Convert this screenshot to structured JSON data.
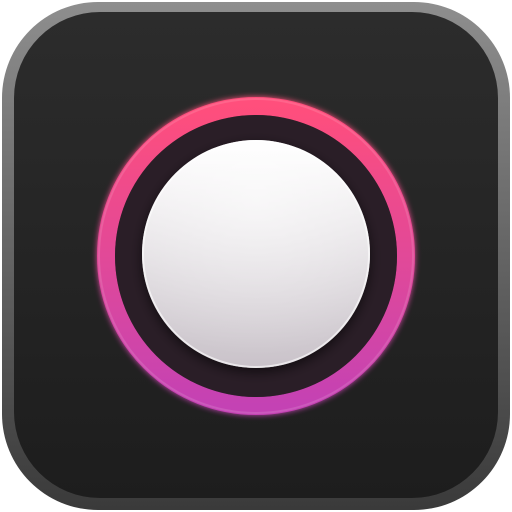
{
  "icon": {
    "name": "record-button-app-icon",
    "colors": {
      "frame_light": "#8e8e8e",
      "frame_dark": "#3a3a3a",
      "tile_top": "#2c2c2c",
      "tile_bottom": "#1d1d1d",
      "ring_top": "#ff4f7c",
      "ring_bottom": "#c442b4",
      "gap_fill": "#2a1e27",
      "button_top": "#ffffff",
      "button_bottom": "#c9c2c9"
    }
  }
}
